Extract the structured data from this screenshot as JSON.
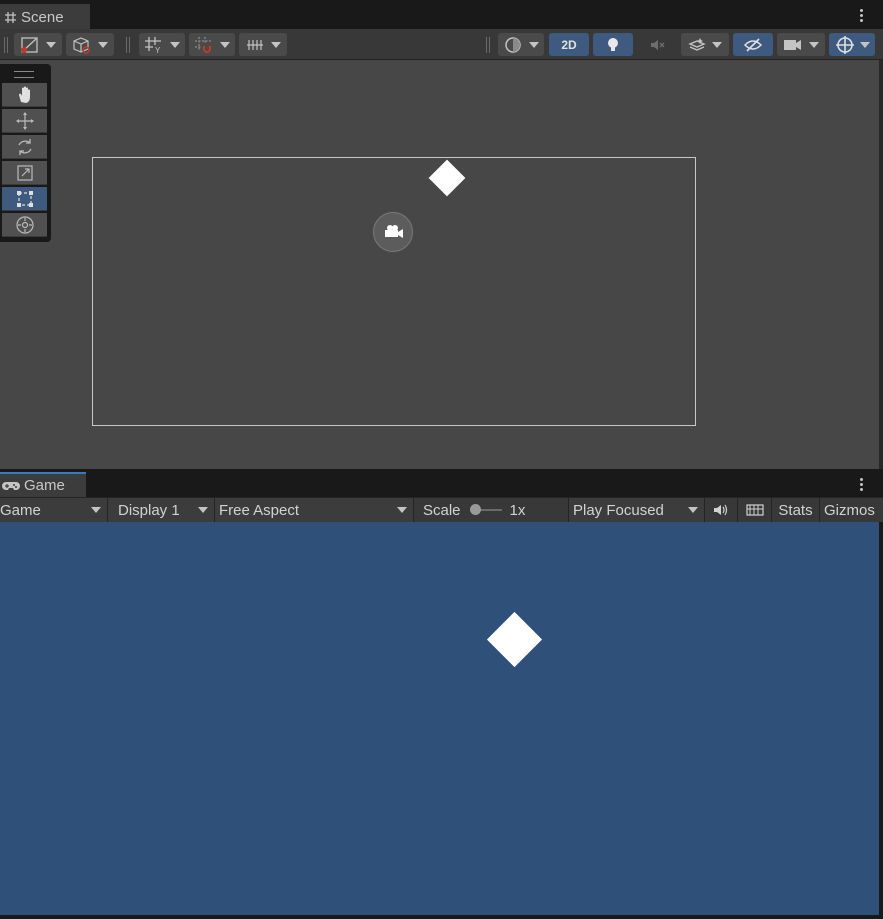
{
  "scene": {
    "tab_label": "Scene",
    "toolbar": {
      "view_2d_label": "2D"
    }
  },
  "game": {
    "tab_label": "Game",
    "toolbar": {
      "view_mode": "Game",
      "display": "Display 1",
      "aspect": "Free Aspect",
      "scale_label": "Scale",
      "scale_value": "1x",
      "play_mode": "Play Focused",
      "stats_label": "Stats",
      "gizmos_label": "Gizmos"
    }
  },
  "colors": {
    "scene_background": "#474747",
    "game_background": "#2f5078",
    "active_accent": "#3e5a7e",
    "tab_highlight": "#3a79bb"
  },
  "icons": {
    "scene_tab": "grid-hash-icon",
    "game_tab": "gamepad-icon",
    "tools": [
      "hand-icon",
      "move-icon",
      "rotate-icon",
      "scale-icon",
      "rect-tool-icon",
      "transform-icon"
    ]
  }
}
